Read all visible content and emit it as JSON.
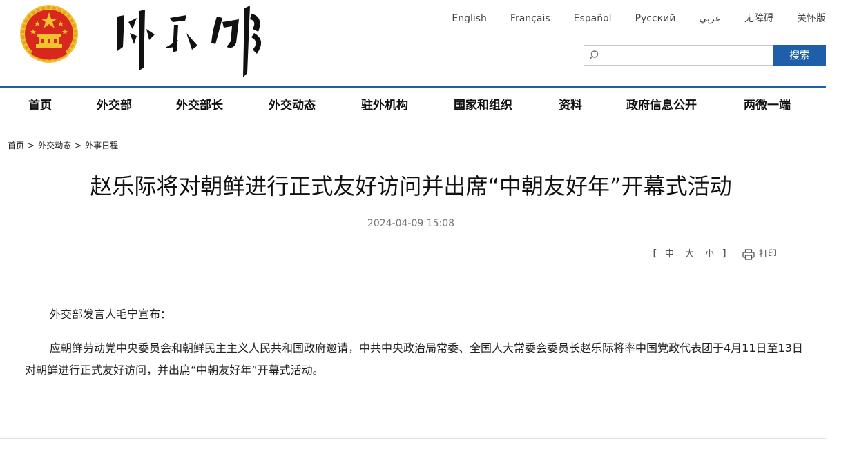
{
  "languages": [
    {
      "label": "English"
    },
    {
      "label": "Français"
    },
    {
      "label": "Español"
    },
    {
      "label": "Русский"
    },
    {
      "label": "عربي"
    },
    {
      "label": "无障碍"
    },
    {
      "label": "关怀版"
    }
  ],
  "search": {
    "button_label": "搜索",
    "placeholder": ""
  },
  "nav": [
    {
      "label": "首页"
    },
    {
      "label": "外交部"
    },
    {
      "label": "外交部长"
    },
    {
      "label": "外交动态"
    },
    {
      "label": "驻外机构"
    },
    {
      "label": "国家和组织"
    },
    {
      "label": "资料"
    },
    {
      "label": "政府信息公开"
    },
    {
      "label": "两微一端"
    }
  ],
  "breadcrumb": {
    "home": "首页",
    "section": "外交动态",
    "current": "外事日程",
    "separator": ">"
  },
  "article": {
    "title": "赵乐际将对朝鲜进行正式友好访问并出席“中朝友好年”开幕式活动",
    "date": "2024-04-09 15:08",
    "font_tools": {
      "open": "【",
      "large": "中",
      "medium": "大",
      "small": "小",
      "close": "】"
    },
    "print_label": "打印",
    "paragraphs": [
      "外交部发言人毛宁宣布：",
      "应朝鲜劳动党中央委员会和朝鲜民主主义人民共和国政府邀请，中共中央政治局常委、全国人大常委会委员长赵乐际将率中国党政代表团于4月11日至13日对朝鲜进行正式友好访问，并出席“中朝友好年”开幕式活动。"
    ]
  },
  "colors": {
    "accent": "#1f5ea8",
    "emblem_red": "#d8281d",
    "emblem_gold": "#f2c230"
  },
  "icons": {
    "emblem": "national-emblem-icon",
    "search": "search-icon",
    "print": "printer-icon"
  }
}
